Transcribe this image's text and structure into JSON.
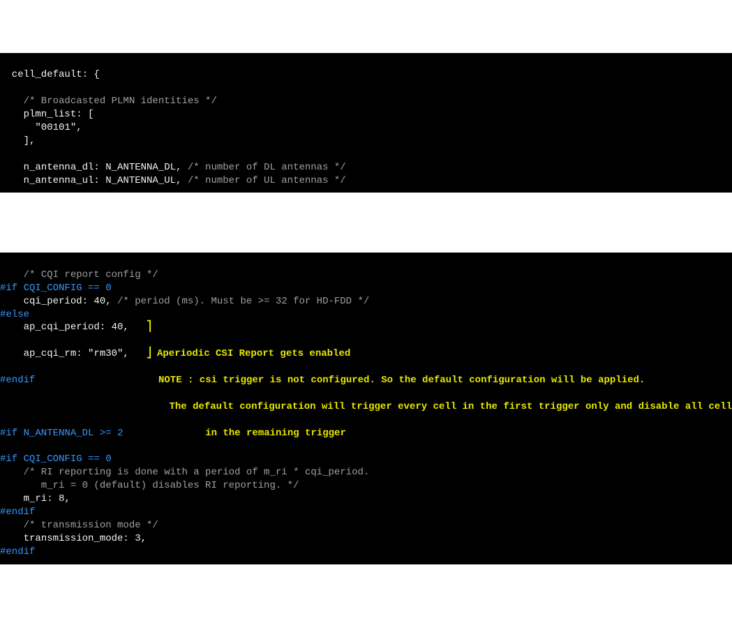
{
  "block1": {
    "l1": "  cell_default: {",
    "l2": "",
    "l3": "    /* Broadcasted PLMN identities */",
    "l4": "    plmn_list: [",
    "l5": "      \"00101\",",
    "l6": "    ],",
    "l7": "",
    "l8_a": "    n_antenna_dl: N_ANTENNA_DL, ",
    "l8_b": "/* number of DL antennas */",
    "l9_a": "    n_antenna_ul: N_ANTENNA_UL, ",
    "l9_b": "/* number of UL antennas */"
  },
  "block2": {
    "l1": "    /* CQI report config */",
    "l2": "#if CQI_CONFIG == 0",
    "l3_a": "    cqi_period: 40, ",
    "l3_b": "/* period (ms). Must be >= 32 for HD-FDD */",
    "l4": "#else",
    "l5": "    ap_cqi_period: 40,",
    "l6": "    ap_cqi_rm: \"rm30\",",
    "l7": "#endif",
    "l8": "",
    "l9": "#if N_ANTENNA_DL >= 2",
    "l10": "#if CQI_CONFIG == 0",
    "l11": "    /* RI reporting is done with a period of m_ri * cqi_period.",
    "l12": "       m_ri = 0 (default) disables RI reporting. */",
    "l13": "    m_ri: 8,",
    "l14": "#endif",
    "l15": "    /* transmission mode */",
    "l16": "    transmission_mode: 3,",
    "l17": "#endif"
  },
  "annot": {
    "brace_top": "⎤",
    "brace_bot": "⎦",
    "a1": "Aperiodic CSI Report gets enabled",
    "a2": "NOTE : csi trigger is not configured. So the default configuration will be applied.",
    "a3": "       The default configuration will trigger every cell in the first trigger only and disable all cell",
    "a4": "        in the remaining trigger"
  }
}
